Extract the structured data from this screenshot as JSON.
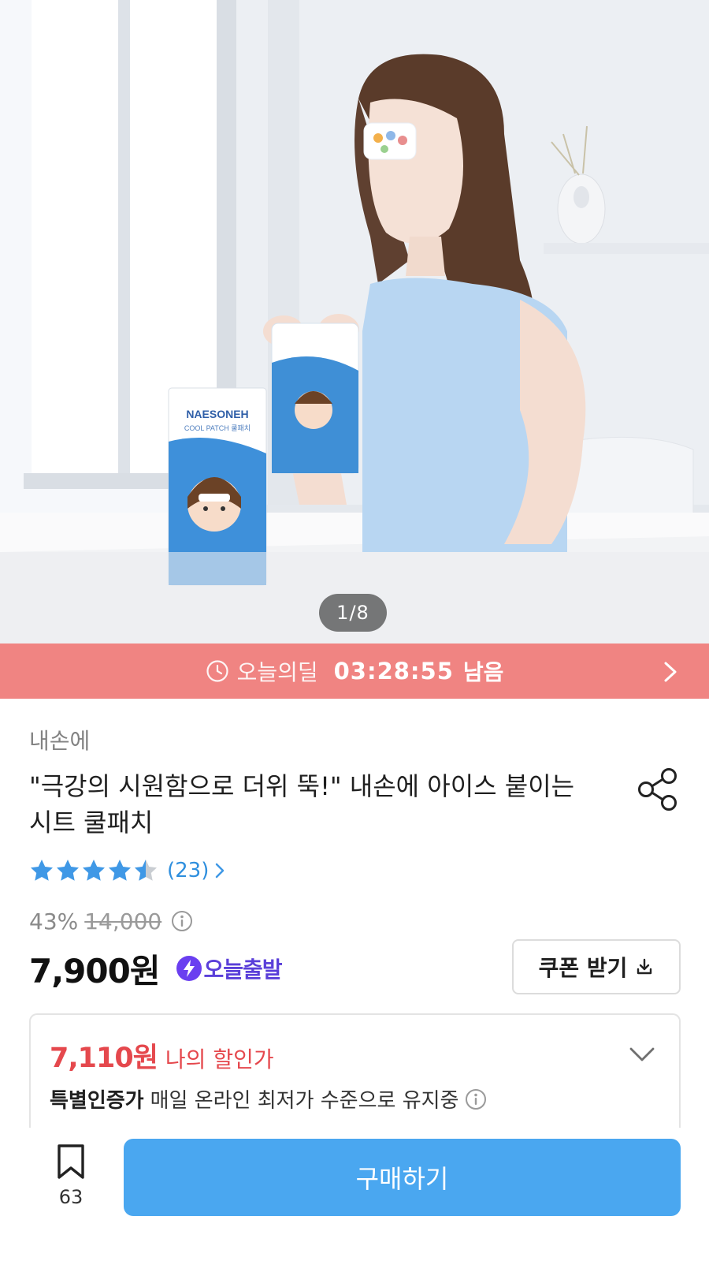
{
  "gallery": {
    "current": "1",
    "separator": "/",
    "total": "8",
    "package_brand": "NAESONEH",
    "package_subtitle": "COOL PATCH 쿨패치"
  },
  "deal_banner": {
    "icon": "clock-icon",
    "label": "오늘의딜",
    "countdown": "03:28:55",
    "suffix": "남음",
    "background": "#f08482"
  },
  "product": {
    "brand": "내손에",
    "title_line1": "\"극강의 시원함으로 더위 뚝!\" 내손에 아이스 붙이는",
    "title_line2": "시트 쿨패치",
    "share_icon": "share-icon",
    "rating": 4.5,
    "review_count": "(23)",
    "discount_percent": "43%",
    "original_price": "14,000",
    "price": "7,900원",
    "delivery_badge": "오늘출발",
    "coupon_label": "쿠폰 받기",
    "accent_blue": "#4aa7f0",
    "badge_purple": "#5a3fd9"
  },
  "my_deal": {
    "price": "7,110원",
    "label": "나의 할인가",
    "cert_title": "특별인증가",
    "cert_desc": "매일 온라인 최저가 수준으로 유지중",
    "accent_red": "#e5484d"
  },
  "bottom_bar": {
    "bookmark_count": "63",
    "buy_label": "구매하기"
  }
}
